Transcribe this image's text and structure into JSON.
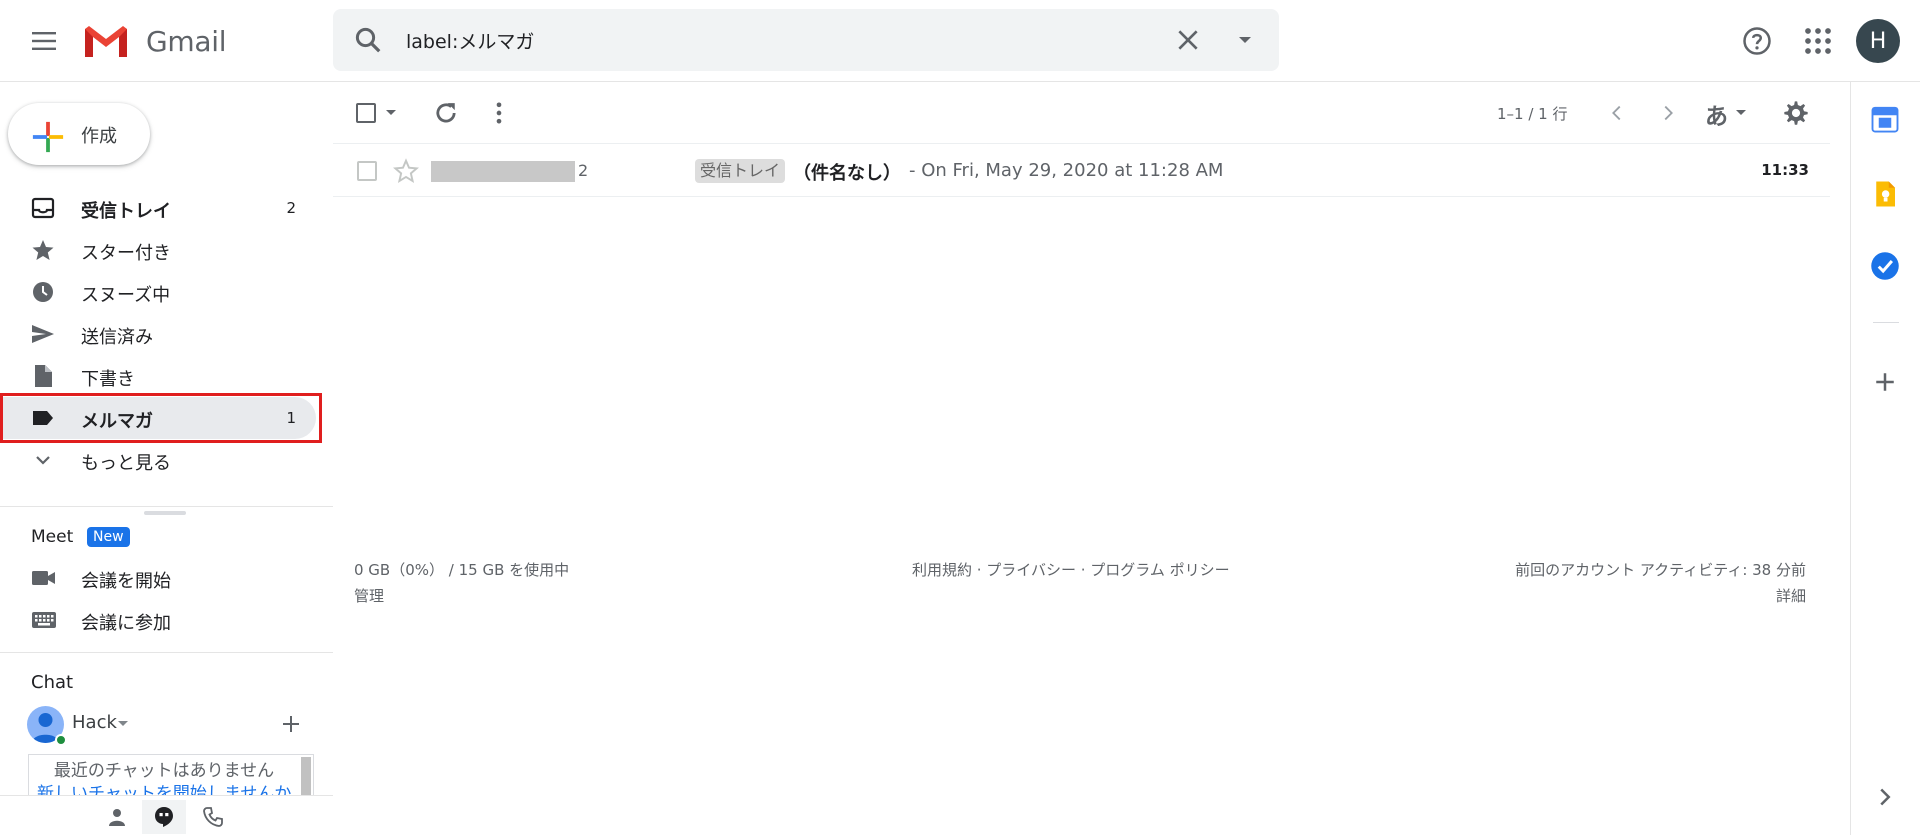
{
  "header": {
    "logo_text": "Gmail",
    "search_value": "label:メルマガ",
    "avatar_initial": "H"
  },
  "compose": {
    "label": "作成"
  },
  "nav": {
    "items": [
      {
        "label": "受信トレイ",
        "count": "2",
        "icon": "inbox-icon"
      },
      {
        "label": "スター付き",
        "count": "",
        "icon": "star-icon"
      },
      {
        "label": "スヌーズ中",
        "count": "",
        "icon": "clock-icon"
      },
      {
        "label": "送信済み",
        "count": "",
        "icon": "send-icon"
      },
      {
        "label": "下書き",
        "count": "",
        "icon": "draft-icon"
      },
      {
        "label": "メルマガ",
        "count": "1",
        "icon": "label-icon"
      },
      {
        "label": "もっと見る",
        "count": "",
        "icon": "chevron-down-icon"
      }
    ]
  },
  "meet": {
    "title": "Meet",
    "badge": "New",
    "start_label": "会議を開始",
    "join_label": "会議に参加"
  },
  "chat": {
    "title": "Chat",
    "user_name": "Hack",
    "empty_line1": "最近のチャットはありません",
    "empty_line2": "新しいチャットを開始しませんか"
  },
  "toolbar": {
    "range": "1–1 / 1 行",
    "lang": "あ"
  },
  "messages": [
    {
      "count": "2",
      "tag": "受信トレイ",
      "subject": "（件名なし）",
      "snippet": "- On Fri, May 29, 2020 at 11:28 AM",
      "time": "11:33"
    }
  ],
  "footer": {
    "storage": "0 GB（0%） / 15 GB を使用中",
    "manage": "管理",
    "links": "利用規約 · プライバシー · プログラム ポリシー",
    "activity": "前回のアカウント アクティビティ: 38 分前",
    "details": "詳細"
  },
  "colors": {
    "highlight_border": "#e01e1e",
    "accent_blue": "#1a73e8",
    "active_nav_bg": "#e8eaed"
  }
}
